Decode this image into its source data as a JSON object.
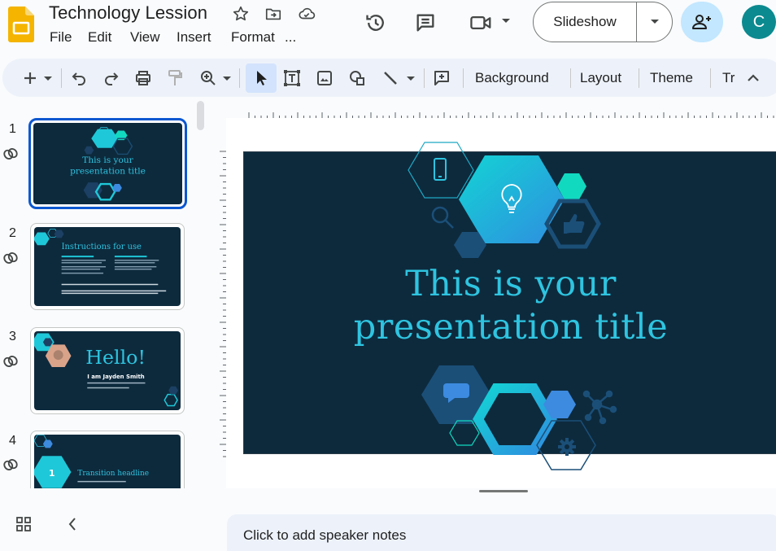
{
  "header": {
    "title": "Technology Lession",
    "menu": [
      "File",
      "Edit",
      "View",
      "Insert",
      "Format",
      "..."
    ],
    "slideshow_label": "Slideshow",
    "avatar_initial": "C",
    "icons": [
      "star-icon",
      "move-to-folder-icon",
      "cloud-status-icon",
      "version-history-icon",
      "comments-icon",
      "meet-icon",
      "share-add-person-icon"
    ]
  },
  "toolbar": {
    "background_label": "Background",
    "layout_label": "Layout",
    "theme_label": "Theme",
    "transition_label": "Tr",
    "icons": [
      "add-icon",
      "undo-icon",
      "redo-icon",
      "print-icon",
      "paint-format-icon",
      "zoom-icon",
      "select-icon",
      "text-box-icon",
      "image-icon",
      "shapes-icon",
      "line-icon",
      "add-comment-icon",
      "collapse-toolbar-icon"
    ]
  },
  "filmstrip": {
    "slides": [
      {
        "number": "1",
        "title": "This is your presentation title"
      },
      {
        "number": "2",
        "title": "Instructions for use"
      },
      {
        "number": "3",
        "title": "Hello!",
        "subtitle": "I am Jayden Smith"
      },
      {
        "number": "4",
        "title": "Transition headline",
        "badge": "1"
      }
    ]
  },
  "main_slide": {
    "title_line1": "This is your",
    "title_line2": "presentation title"
  },
  "notes": {
    "placeholder": "Click to add speaker notes"
  },
  "colors": {
    "slide_bg": "#0d2a3d",
    "accent_cyan": "#2ec4e0",
    "accent_blue": "#0b57d0",
    "avatar_bg": "#0b8a8f",
    "share_bg": "#c2e7ff"
  }
}
